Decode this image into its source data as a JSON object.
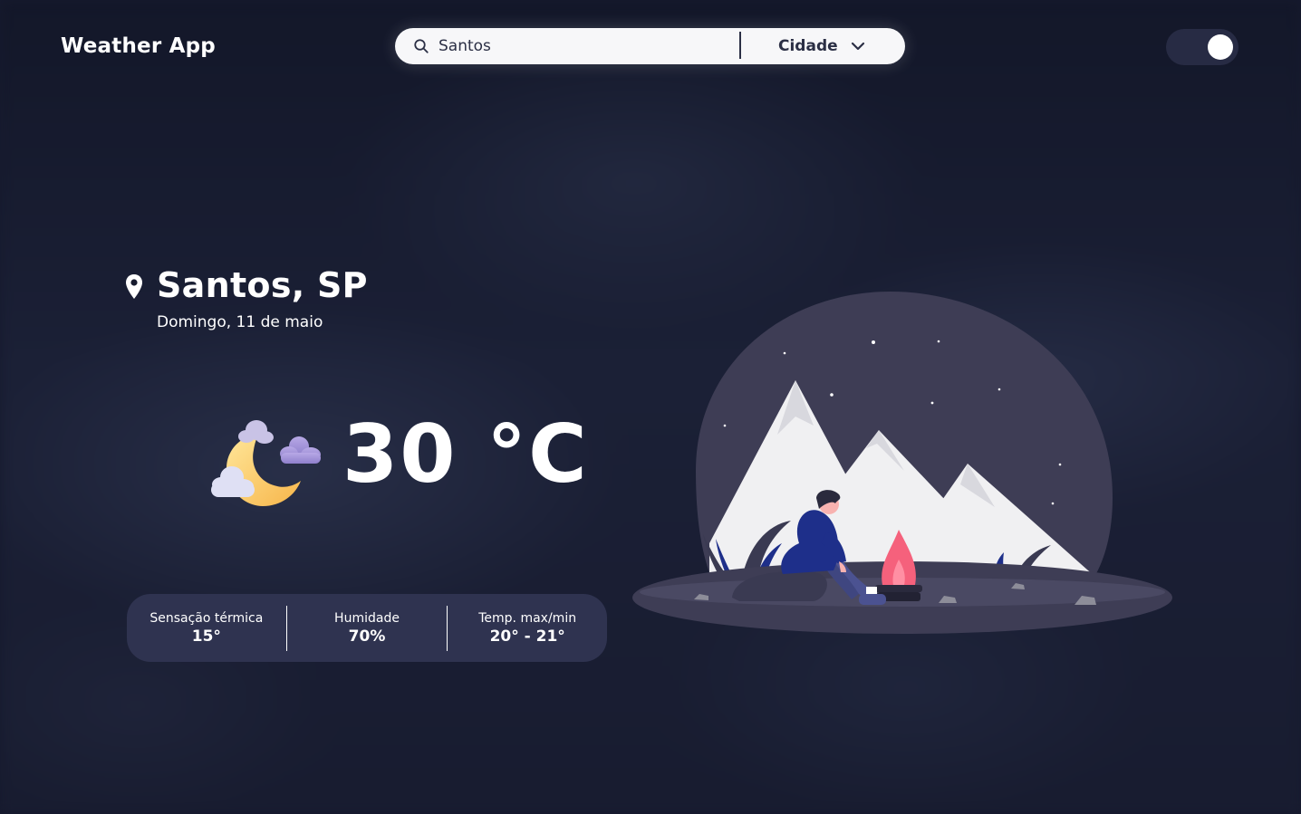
{
  "header": {
    "app_title": "Weather App",
    "search": {
      "value": "Santos",
      "placeholder": "Santos",
      "type_label": "Cidade"
    },
    "theme_toggle": {
      "state": "on"
    }
  },
  "location": {
    "city": "Santos, SP",
    "date": "Domingo, 11 de maio"
  },
  "current": {
    "icon": "moon-clouds-icon",
    "temperature": "30 °C"
  },
  "stats": [
    {
      "label": "Sensação térmica",
      "value": "15°"
    },
    {
      "label": "Humidade",
      "value": "70%"
    },
    {
      "label": "Temp. max/min",
      "value": "20° - 21°"
    }
  ],
  "colors": {
    "background": "#161a2e",
    "panel": "#2f3350",
    "toggle": "#272b44",
    "accent_fire": "#f5617c",
    "accent_blue": "#1e2f8a"
  },
  "illustration": "night-camping-illustration"
}
